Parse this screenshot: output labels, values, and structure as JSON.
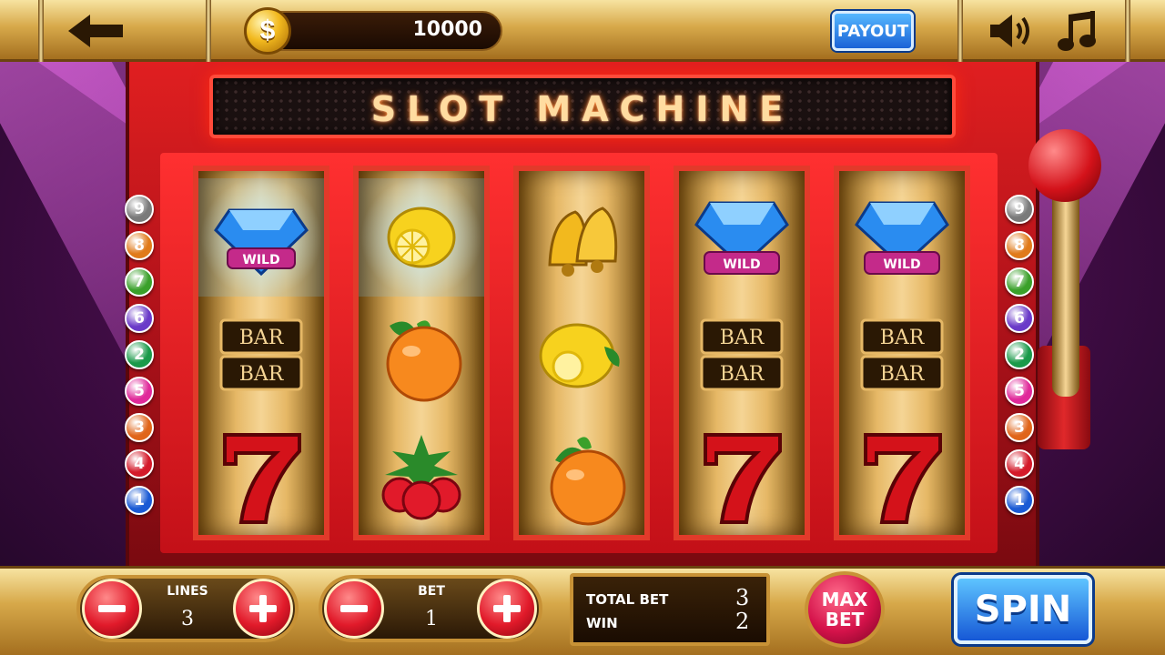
{
  "header": {
    "coin_symbol": "$",
    "balance": "10000",
    "payout_label": "PAYOUT",
    "back_icon": "back-arrow-icon",
    "sound_icon": "speaker-icon",
    "music_icon": "music-note-icon"
  },
  "title": "SLOT MACHINE",
  "reels": [
    {
      "symbols": [
        "diamond-wild",
        "bar-double",
        "seven"
      ],
      "wild_label": "WILD",
      "bar_label": "BAR"
    },
    {
      "symbols": [
        "lemon",
        "orange",
        "strawberries"
      ]
    },
    {
      "symbols": [
        "bells",
        "lemon",
        "orange"
      ]
    },
    {
      "symbols": [
        "diamond-wild",
        "bar-double",
        "seven"
      ],
      "wild_label": "WILD",
      "bar_label": "BAR"
    },
    {
      "symbols": [
        "diamond-wild",
        "bar-double",
        "seven"
      ],
      "wild_label": "WILD",
      "bar_label": "BAR"
    }
  ],
  "paylines_left": [
    "9",
    "8",
    "7",
    "6",
    "2",
    "5",
    "3",
    "4",
    "1"
  ],
  "paylines_right": [
    "9",
    "8",
    "7",
    "6",
    "2",
    "5",
    "3",
    "4",
    "1"
  ],
  "payline_colors": [
    "#7a7a7a",
    "#e07a1a",
    "#3aa02a",
    "#6a3ac8",
    "#1a9a4a",
    "#e02a9a",
    "#e0651a",
    "#d41a2a",
    "#1a5ad4"
  ],
  "controls": {
    "lines_label": "LINES",
    "lines_value": "3",
    "bet_label": "BET",
    "bet_value": "1",
    "total_bet_label": "TOTAL BET",
    "total_bet_value": "3",
    "win_label": "WIN",
    "win_value": "2",
    "max_bet_line1": "MAX",
    "max_bet_line2": "BET",
    "spin_label": "SPIN"
  }
}
